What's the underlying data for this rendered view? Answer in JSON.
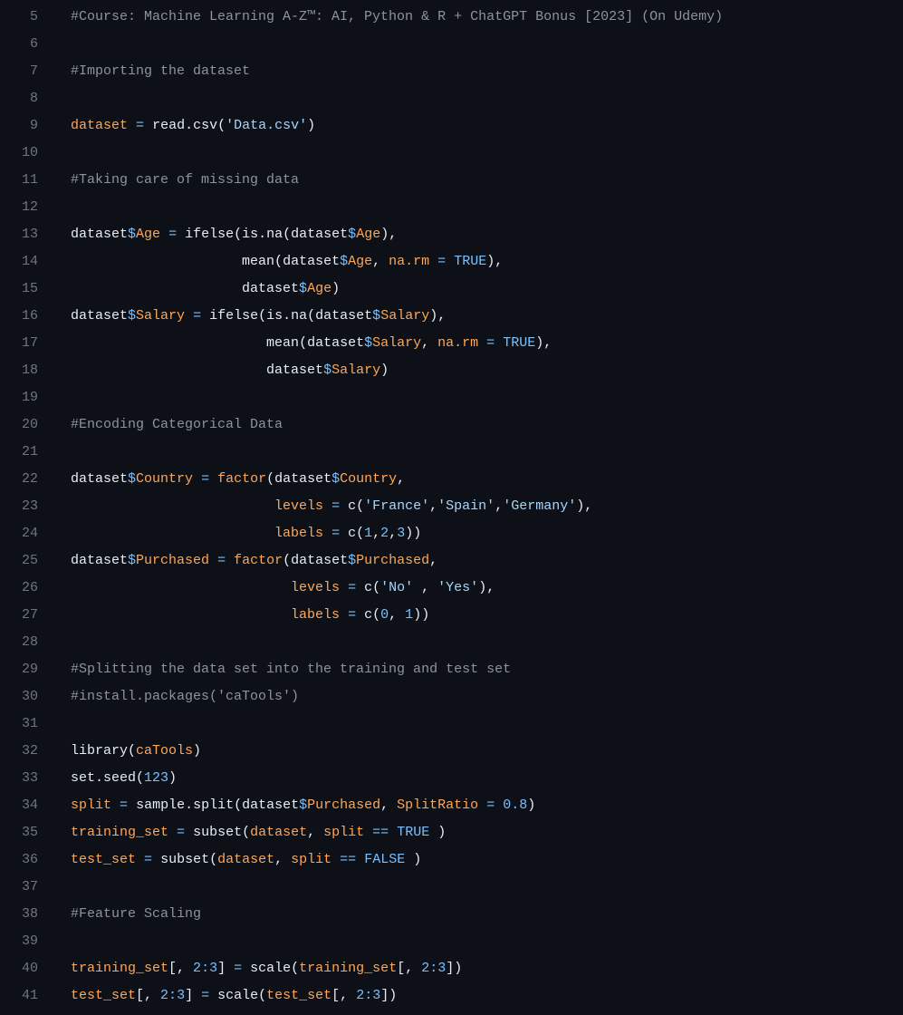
{
  "colors": {
    "background": "#0d1117",
    "gutter": "#6e7681",
    "default": "#e6edf3",
    "comment": "#8b949e",
    "accessor": "#ffa657",
    "keyword_blue": "#79c0ff",
    "string": "#a5d6ff",
    "keyword_red": "#ff7b72",
    "funccall": "#d2a8ff"
  },
  "first_line_number": 5,
  "lines": [
    {
      "n": 5,
      "tokens": [
        {
          "t": "#Course: Machine Learning A-Z™: AI, Python & R + ChatGPT Bonus [2023] (On Udemy)",
          "c": "tok-comment"
        }
      ]
    },
    {
      "n": 6,
      "tokens": []
    },
    {
      "n": 7,
      "tokens": [
        {
          "t": "#Importing the dataset",
          "c": "tok-comment"
        }
      ]
    },
    {
      "n": 8,
      "tokens": []
    },
    {
      "n": 9,
      "tokens": [
        {
          "t": "dataset",
          "c": "tok-accessor"
        },
        {
          "t": " ",
          "c": "tok-ident"
        },
        {
          "t": "=",
          "c": "tok-op"
        },
        {
          "t": " ",
          "c": "tok-ident"
        },
        {
          "t": "read.csv",
          "c": "tok-ident"
        },
        {
          "t": "(",
          "c": "tok-paren"
        },
        {
          "t": "'Data.csv'",
          "c": "tok-string"
        },
        {
          "t": ")",
          "c": "tok-paren"
        }
      ]
    },
    {
      "n": 10,
      "tokens": []
    },
    {
      "n": 11,
      "tokens": [
        {
          "t": "#Taking care of missing data",
          "c": "tok-comment"
        }
      ]
    },
    {
      "n": 12,
      "tokens": []
    },
    {
      "n": 13,
      "tokens": [
        {
          "t": "dataset",
          "c": "tok-ident"
        },
        {
          "t": "$",
          "c": "tok-dollar"
        },
        {
          "t": "Age",
          "c": "tok-accessor"
        },
        {
          "t": " ",
          "c": "tok-ident"
        },
        {
          "t": "=",
          "c": "tok-op"
        },
        {
          "t": " ",
          "c": "tok-ident"
        },
        {
          "t": "ifelse",
          "c": "tok-ident"
        },
        {
          "t": "(",
          "c": "tok-paren"
        },
        {
          "t": "is.na",
          "c": "tok-ident"
        },
        {
          "t": "(",
          "c": "tok-paren"
        },
        {
          "t": "dataset",
          "c": "tok-ident"
        },
        {
          "t": "$",
          "c": "tok-dollar"
        },
        {
          "t": "Age",
          "c": "tok-accessor"
        },
        {
          "t": ")",
          "c": "tok-paren"
        },
        {
          "t": ",",
          "c": "tok-ident"
        }
      ]
    },
    {
      "n": 14,
      "tokens": [
        {
          "t": "                     ",
          "c": "tok-ident"
        },
        {
          "t": "mean",
          "c": "tok-ident"
        },
        {
          "t": "(",
          "c": "tok-paren"
        },
        {
          "t": "dataset",
          "c": "tok-ident"
        },
        {
          "t": "$",
          "c": "tok-dollar"
        },
        {
          "t": "Age",
          "c": "tok-accessor"
        },
        {
          "t": ", ",
          "c": "tok-ident"
        },
        {
          "t": "na.rm",
          "c": "tok-accessor"
        },
        {
          "t": " ",
          "c": "tok-ident"
        },
        {
          "t": "=",
          "c": "tok-op"
        },
        {
          "t": " ",
          "c": "tok-ident"
        },
        {
          "t": "TRUE",
          "c": "tok-const"
        },
        {
          "t": ")",
          "c": "tok-paren"
        },
        {
          "t": ",",
          "c": "tok-ident"
        }
      ]
    },
    {
      "n": 15,
      "tokens": [
        {
          "t": "                     ",
          "c": "tok-ident"
        },
        {
          "t": "dataset",
          "c": "tok-ident"
        },
        {
          "t": "$",
          "c": "tok-dollar"
        },
        {
          "t": "Age",
          "c": "tok-accessor"
        },
        {
          "t": ")",
          "c": "tok-paren"
        }
      ]
    },
    {
      "n": 16,
      "tokens": [
        {
          "t": "dataset",
          "c": "tok-ident"
        },
        {
          "t": "$",
          "c": "tok-dollar"
        },
        {
          "t": "Salary",
          "c": "tok-accessor"
        },
        {
          "t": " ",
          "c": "tok-ident"
        },
        {
          "t": "=",
          "c": "tok-op"
        },
        {
          "t": " ",
          "c": "tok-ident"
        },
        {
          "t": "ifelse",
          "c": "tok-ident"
        },
        {
          "t": "(",
          "c": "tok-paren"
        },
        {
          "t": "is.na",
          "c": "tok-ident"
        },
        {
          "t": "(",
          "c": "tok-paren"
        },
        {
          "t": "dataset",
          "c": "tok-ident"
        },
        {
          "t": "$",
          "c": "tok-dollar"
        },
        {
          "t": "Salary",
          "c": "tok-accessor"
        },
        {
          "t": ")",
          "c": "tok-paren"
        },
        {
          "t": ",",
          "c": "tok-ident"
        }
      ]
    },
    {
      "n": 17,
      "tokens": [
        {
          "t": "                        ",
          "c": "tok-ident"
        },
        {
          "t": "mean",
          "c": "tok-ident"
        },
        {
          "t": "(",
          "c": "tok-paren"
        },
        {
          "t": "dataset",
          "c": "tok-ident"
        },
        {
          "t": "$",
          "c": "tok-dollar"
        },
        {
          "t": "Salary",
          "c": "tok-accessor"
        },
        {
          "t": ", ",
          "c": "tok-ident"
        },
        {
          "t": "na.rm",
          "c": "tok-accessor"
        },
        {
          "t": " ",
          "c": "tok-ident"
        },
        {
          "t": "=",
          "c": "tok-op"
        },
        {
          "t": " ",
          "c": "tok-ident"
        },
        {
          "t": "TRUE",
          "c": "tok-const"
        },
        {
          "t": ")",
          "c": "tok-paren"
        },
        {
          "t": ",",
          "c": "tok-ident"
        }
      ]
    },
    {
      "n": 18,
      "tokens": [
        {
          "t": "                        ",
          "c": "tok-ident"
        },
        {
          "t": "dataset",
          "c": "tok-ident"
        },
        {
          "t": "$",
          "c": "tok-dollar"
        },
        {
          "t": "Salary",
          "c": "tok-accessor"
        },
        {
          "t": ")",
          "c": "tok-paren"
        }
      ]
    },
    {
      "n": 19,
      "tokens": []
    },
    {
      "n": 20,
      "tokens": [
        {
          "t": "#Encoding Categorical Data",
          "c": "tok-comment"
        }
      ]
    },
    {
      "n": 21,
      "tokens": []
    },
    {
      "n": 22,
      "tokens": [
        {
          "t": "dataset",
          "c": "tok-ident"
        },
        {
          "t": "$",
          "c": "tok-dollar"
        },
        {
          "t": "Country",
          "c": "tok-accessor"
        },
        {
          "t": " ",
          "c": "tok-ident"
        },
        {
          "t": "=",
          "c": "tok-op"
        },
        {
          "t": " ",
          "c": "tok-ident"
        },
        {
          "t": "factor",
          "c": "tok-accessor"
        },
        {
          "t": "(",
          "c": "tok-paren"
        },
        {
          "t": "dataset",
          "c": "tok-ident"
        },
        {
          "t": "$",
          "c": "tok-dollar"
        },
        {
          "t": "Country",
          "c": "tok-accessor"
        },
        {
          "t": ",",
          "c": "tok-ident"
        }
      ]
    },
    {
      "n": 23,
      "tokens": [
        {
          "t": "                         ",
          "c": "tok-ident"
        },
        {
          "t": "levels",
          "c": "tok-accessor"
        },
        {
          "t": " ",
          "c": "tok-ident"
        },
        {
          "t": "=",
          "c": "tok-op"
        },
        {
          "t": " ",
          "c": "tok-ident"
        },
        {
          "t": "c",
          "c": "tok-ident"
        },
        {
          "t": "(",
          "c": "tok-paren"
        },
        {
          "t": "'France'",
          "c": "tok-string"
        },
        {
          "t": ",",
          "c": "tok-ident"
        },
        {
          "t": "'Spain'",
          "c": "tok-string"
        },
        {
          "t": ",",
          "c": "tok-ident"
        },
        {
          "t": "'Germany'",
          "c": "tok-string"
        },
        {
          "t": ")",
          "c": "tok-paren"
        },
        {
          "t": ",",
          "c": "tok-ident"
        }
      ]
    },
    {
      "n": 24,
      "tokens": [
        {
          "t": "                         ",
          "c": "tok-ident"
        },
        {
          "t": "labels",
          "c": "tok-accessor"
        },
        {
          "t": " ",
          "c": "tok-ident"
        },
        {
          "t": "=",
          "c": "tok-op"
        },
        {
          "t": " ",
          "c": "tok-ident"
        },
        {
          "t": "c",
          "c": "tok-ident"
        },
        {
          "t": "(",
          "c": "tok-paren"
        },
        {
          "t": "1",
          "c": "tok-num"
        },
        {
          "t": ",",
          "c": "tok-ident"
        },
        {
          "t": "2",
          "c": "tok-num"
        },
        {
          "t": ",",
          "c": "tok-ident"
        },
        {
          "t": "3",
          "c": "tok-num"
        },
        {
          "t": "))",
          "c": "tok-paren"
        }
      ]
    },
    {
      "n": 25,
      "tokens": [
        {
          "t": "dataset",
          "c": "tok-ident"
        },
        {
          "t": "$",
          "c": "tok-dollar"
        },
        {
          "t": "Purchased",
          "c": "tok-accessor"
        },
        {
          "t": " ",
          "c": "tok-ident"
        },
        {
          "t": "=",
          "c": "tok-op"
        },
        {
          "t": " ",
          "c": "tok-ident"
        },
        {
          "t": "factor",
          "c": "tok-accessor"
        },
        {
          "t": "(",
          "c": "tok-paren"
        },
        {
          "t": "dataset",
          "c": "tok-ident"
        },
        {
          "t": "$",
          "c": "tok-dollar"
        },
        {
          "t": "Purchased",
          "c": "tok-accessor"
        },
        {
          "t": ",",
          "c": "tok-ident"
        }
      ]
    },
    {
      "n": 26,
      "tokens": [
        {
          "t": "                           ",
          "c": "tok-ident"
        },
        {
          "t": "levels",
          "c": "tok-accessor"
        },
        {
          "t": " ",
          "c": "tok-ident"
        },
        {
          "t": "=",
          "c": "tok-op"
        },
        {
          "t": " ",
          "c": "tok-ident"
        },
        {
          "t": "c",
          "c": "tok-ident"
        },
        {
          "t": "(",
          "c": "tok-paren"
        },
        {
          "t": "'No'",
          "c": "tok-string"
        },
        {
          "t": " , ",
          "c": "tok-ident"
        },
        {
          "t": "'Yes'",
          "c": "tok-string"
        },
        {
          "t": ")",
          "c": "tok-paren"
        },
        {
          "t": ",",
          "c": "tok-ident"
        }
      ]
    },
    {
      "n": 27,
      "tokens": [
        {
          "t": "                           ",
          "c": "tok-ident"
        },
        {
          "t": "labels",
          "c": "tok-accessor"
        },
        {
          "t": " ",
          "c": "tok-ident"
        },
        {
          "t": "=",
          "c": "tok-op"
        },
        {
          "t": " ",
          "c": "tok-ident"
        },
        {
          "t": "c",
          "c": "tok-ident"
        },
        {
          "t": "(",
          "c": "tok-paren"
        },
        {
          "t": "0",
          "c": "tok-num"
        },
        {
          "t": ", ",
          "c": "tok-ident"
        },
        {
          "t": "1",
          "c": "tok-num"
        },
        {
          "t": "))",
          "c": "tok-paren"
        }
      ]
    },
    {
      "n": 28,
      "tokens": []
    },
    {
      "n": 29,
      "tokens": [
        {
          "t": "#Splitting the data set into the training and test set",
          "c": "tok-comment"
        }
      ]
    },
    {
      "n": 30,
      "tokens": [
        {
          "t": "#install.packages('caTools')",
          "c": "tok-comment"
        }
      ]
    },
    {
      "n": 31,
      "tokens": []
    },
    {
      "n": 32,
      "tokens": [
        {
          "t": "library",
          "c": "tok-ident"
        },
        {
          "t": "(",
          "c": "tok-paren"
        },
        {
          "t": "caTools",
          "c": "tok-accessor"
        },
        {
          "t": ")",
          "c": "tok-paren"
        }
      ]
    },
    {
      "n": 33,
      "tokens": [
        {
          "t": "set.seed",
          "c": "tok-ident"
        },
        {
          "t": "(",
          "c": "tok-paren"
        },
        {
          "t": "123",
          "c": "tok-num"
        },
        {
          "t": ")",
          "c": "tok-paren"
        }
      ]
    },
    {
      "n": 34,
      "tokens": [
        {
          "t": "split",
          "c": "tok-accessor"
        },
        {
          "t": " ",
          "c": "tok-ident"
        },
        {
          "t": "=",
          "c": "tok-op"
        },
        {
          "t": " ",
          "c": "tok-ident"
        },
        {
          "t": "sample.split",
          "c": "tok-ident"
        },
        {
          "t": "(",
          "c": "tok-paren"
        },
        {
          "t": "dataset",
          "c": "tok-ident"
        },
        {
          "t": "$",
          "c": "tok-dollar"
        },
        {
          "t": "Purchased",
          "c": "tok-accessor"
        },
        {
          "t": ", ",
          "c": "tok-ident"
        },
        {
          "t": "SplitRatio",
          "c": "tok-accessor"
        },
        {
          "t": " ",
          "c": "tok-ident"
        },
        {
          "t": "=",
          "c": "tok-op"
        },
        {
          "t": " ",
          "c": "tok-ident"
        },
        {
          "t": "0.8",
          "c": "tok-num"
        },
        {
          "t": ")",
          "c": "tok-paren"
        }
      ]
    },
    {
      "n": 35,
      "tokens": [
        {
          "t": "training_set",
          "c": "tok-accessor"
        },
        {
          "t": " ",
          "c": "tok-ident"
        },
        {
          "t": "=",
          "c": "tok-op"
        },
        {
          "t": " ",
          "c": "tok-ident"
        },
        {
          "t": "subset",
          "c": "tok-ident"
        },
        {
          "t": "(",
          "c": "tok-paren"
        },
        {
          "t": "dataset",
          "c": "tok-accessor"
        },
        {
          "t": ", ",
          "c": "tok-ident"
        },
        {
          "t": "split",
          "c": "tok-accessor"
        },
        {
          "t": " ",
          "c": "tok-ident"
        },
        {
          "t": "==",
          "c": "tok-op"
        },
        {
          "t": " ",
          "c": "tok-ident"
        },
        {
          "t": "TRUE",
          "c": "tok-const"
        },
        {
          "t": " )",
          "c": "tok-paren"
        }
      ]
    },
    {
      "n": 36,
      "tokens": [
        {
          "t": "test_set",
          "c": "tok-accessor"
        },
        {
          "t": " ",
          "c": "tok-ident"
        },
        {
          "t": "=",
          "c": "tok-op"
        },
        {
          "t": " ",
          "c": "tok-ident"
        },
        {
          "t": "subset",
          "c": "tok-ident"
        },
        {
          "t": "(",
          "c": "tok-paren"
        },
        {
          "t": "dataset",
          "c": "tok-accessor"
        },
        {
          "t": ", ",
          "c": "tok-ident"
        },
        {
          "t": "split",
          "c": "tok-accessor"
        },
        {
          "t": " ",
          "c": "tok-ident"
        },
        {
          "t": "==",
          "c": "tok-op"
        },
        {
          "t": " ",
          "c": "tok-ident"
        },
        {
          "t": "FALSE",
          "c": "tok-const"
        },
        {
          "t": " )",
          "c": "tok-paren"
        }
      ]
    },
    {
      "n": 37,
      "tokens": []
    },
    {
      "n": 38,
      "tokens": [
        {
          "t": "#Feature Scaling",
          "c": "tok-comment"
        }
      ]
    },
    {
      "n": 39,
      "tokens": []
    },
    {
      "n": 40,
      "tokens": [
        {
          "t": "training_set",
          "c": "tok-accessor"
        },
        {
          "t": "[, ",
          "c": "tok-ident"
        },
        {
          "t": "2",
          "c": "tok-num"
        },
        {
          "t": ":",
          "c": "tok-op"
        },
        {
          "t": "3",
          "c": "tok-num"
        },
        {
          "t": "] ",
          "c": "tok-ident"
        },
        {
          "t": "=",
          "c": "tok-op"
        },
        {
          "t": " ",
          "c": "tok-ident"
        },
        {
          "t": "scale",
          "c": "tok-ident"
        },
        {
          "t": "(",
          "c": "tok-paren"
        },
        {
          "t": "training_set",
          "c": "tok-accessor"
        },
        {
          "t": "[, ",
          "c": "tok-ident"
        },
        {
          "t": "2",
          "c": "tok-num"
        },
        {
          "t": ":",
          "c": "tok-op"
        },
        {
          "t": "3",
          "c": "tok-num"
        },
        {
          "t": "])",
          "c": "tok-paren"
        }
      ]
    },
    {
      "n": 41,
      "tokens": [
        {
          "t": "test_set",
          "c": "tok-accessor"
        },
        {
          "t": "[, ",
          "c": "tok-ident"
        },
        {
          "t": "2",
          "c": "tok-num"
        },
        {
          "t": ":",
          "c": "tok-op"
        },
        {
          "t": "3",
          "c": "tok-num"
        },
        {
          "t": "] ",
          "c": "tok-ident"
        },
        {
          "t": "=",
          "c": "tok-op"
        },
        {
          "t": " ",
          "c": "tok-ident"
        },
        {
          "t": "scale",
          "c": "tok-ident"
        },
        {
          "t": "(",
          "c": "tok-paren"
        },
        {
          "t": "test_set",
          "c": "tok-accessor"
        },
        {
          "t": "[, ",
          "c": "tok-ident"
        },
        {
          "t": "2",
          "c": "tok-num"
        },
        {
          "t": ":",
          "c": "tok-op"
        },
        {
          "t": "3",
          "c": "tok-num"
        },
        {
          "t": "])",
          "c": "tok-paren"
        }
      ]
    }
  ]
}
